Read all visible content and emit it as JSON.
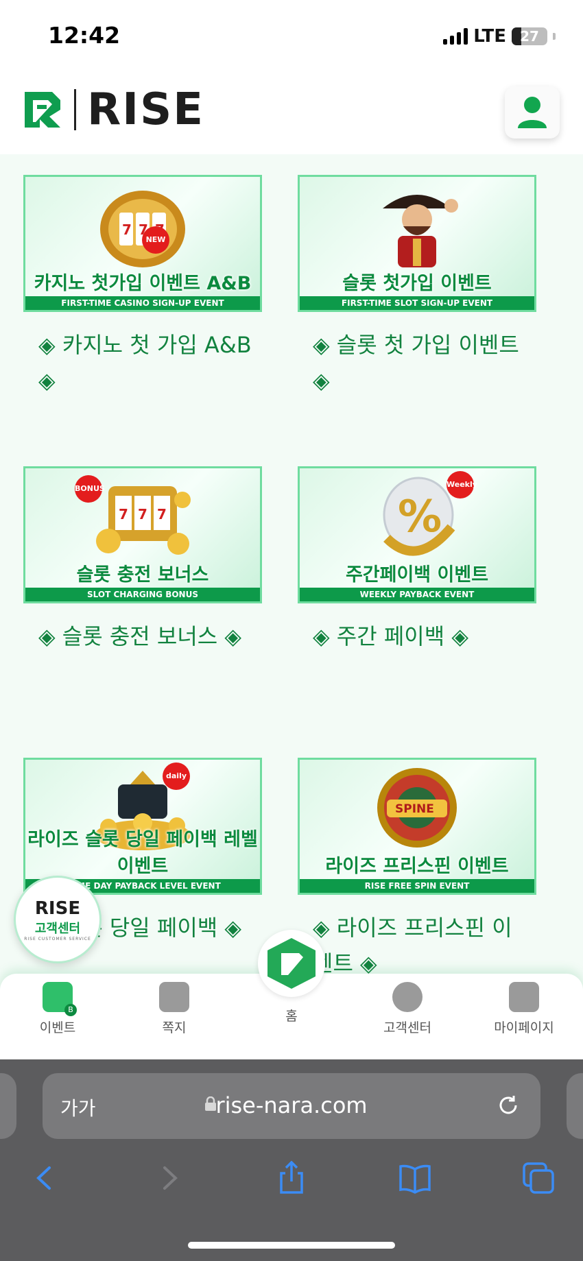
{
  "status": {
    "time": "12:42",
    "network": "LTE",
    "battery": "27",
    "battery_level": 0.27
  },
  "header": {
    "brand": "RISE"
  },
  "events": [
    {
      "banner_ko": "카지노 첫가입 이벤트 A&B",
      "banner_en": "FIRST-TIME CASINO SIGN-UP EVENT",
      "tag": "NEW",
      "title": "◈ 카지노 첫 가입 A&B ◈"
    },
    {
      "banner_ko": "슬롯 첫가입 이벤트",
      "banner_en": "FIRST-TIME SLOT SIGN-UP EVENT",
      "tag": "",
      "title": "◈ 슬롯 첫 가입 이벤트 ◈"
    },
    {
      "banner_ko": "슬롯 충전 보너스",
      "banner_en": "SLOT CHARGING BONUS",
      "tag": "BONUS",
      "title": "◈ 슬롯 충전 보너스 ◈"
    },
    {
      "banner_ko": "주간페이백 이벤트",
      "banner_en": "WEEKLY PAYBACK EVENT",
      "tag": "Weekly",
      "title": "◈ 주간 페이백 ◈"
    },
    {
      "banner_ko": "라이즈 슬롯 당일 페이백 레벨 이벤트",
      "banner_en": "SAME DAY PAYBACK LEVEL EVENT",
      "tag": "daily",
      "title": "◈ 슬롯 당일 페이백 ◈"
    },
    {
      "banner_ko": "라이즈 프리스핀 이벤트",
      "banner_en": "RISE FREE SPIN EVENT",
      "tag": "",
      "title": "◈ 라이즈 프리스핀 이벤트 ◈"
    }
  ],
  "cs_badge": {
    "brand": "RISE",
    "label": "고객센터",
    "sub": "RISE CUSTOMER SERVICE"
  },
  "tabbar": {
    "events": "이벤트",
    "events_badge": "B",
    "messages": "쪽지",
    "home": "홈",
    "support": "고객센터",
    "mypage": "마이페이지"
  },
  "browser": {
    "text_size": "가가",
    "host": "rise-nara.com"
  }
}
